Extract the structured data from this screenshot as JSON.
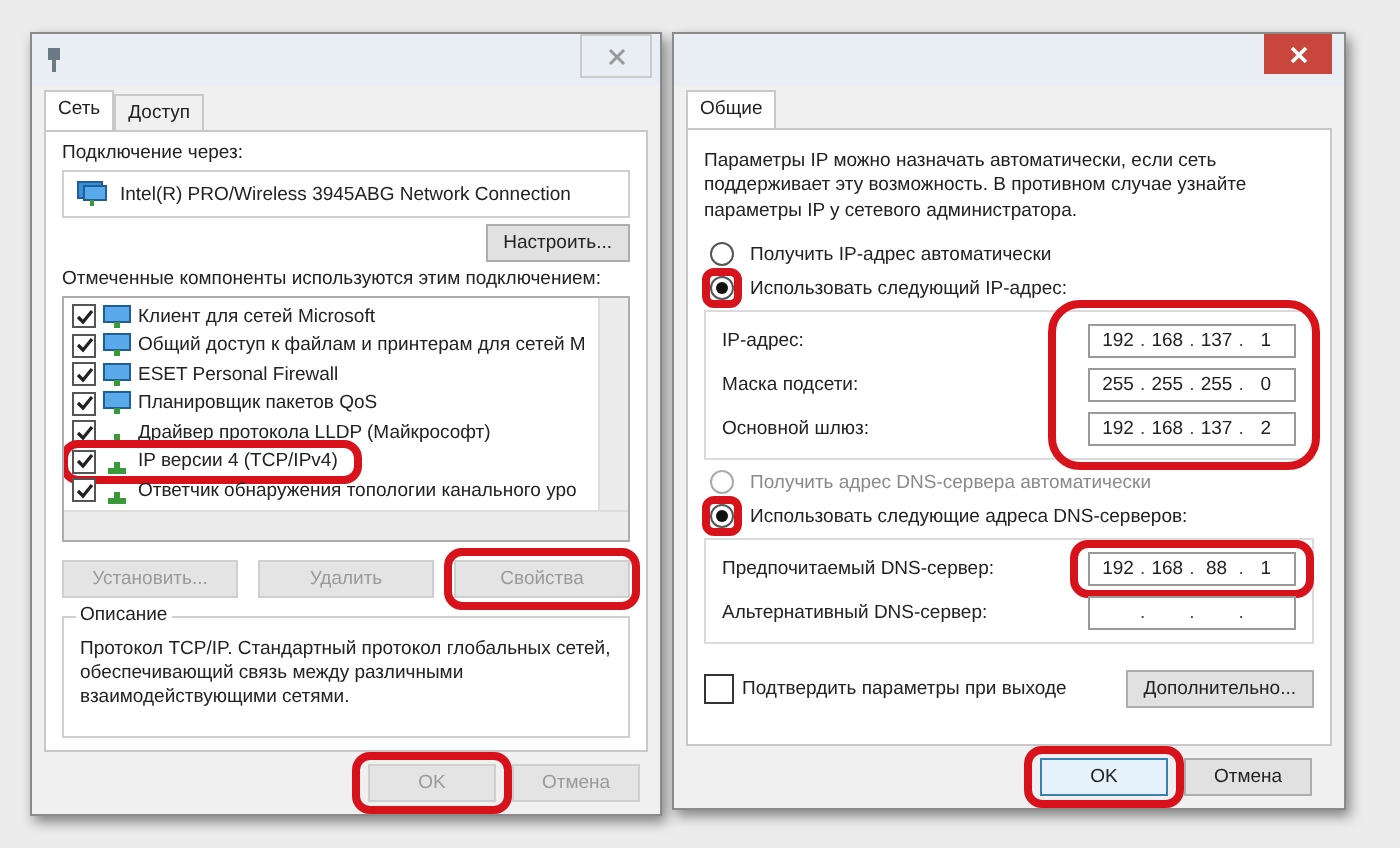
{
  "left_dialog": {
    "tabs": [
      {
        "label": "Сеть",
        "selected": true
      },
      {
        "label": "Доступ",
        "selected": false
      }
    ],
    "connect_via_label": "Подключение через:",
    "adapter": "Intel(R) PRO/Wireless 3945ABG Network Connection",
    "configure_button": "Настроить...",
    "components_label": "Отмеченные компоненты используются этим подключением:",
    "components": [
      {
        "kind": "monitor",
        "label": "Клиент для сетей Microsoft",
        "checked": true
      },
      {
        "kind": "monitor",
        "label": "Общий доступ к файлам и принтерам для сетей M",
        "checked": true
      },
      {
        "kind": "monitor",
        "label": "ESET Personal Firewall",
        "checked": true
      },
      {
        "kind": "monitor",
        "label": "Планировщик пакетов QoS",
        "checked": true
      },
      {
        "kind": "protocol",
        "label": "Драйвер протокола LLDP (Майкрософт)",
        "checked": true
      },
      {
        "kind": "protocol",
        "label": "IP версии 4 (TCP/IPv4)",
        "checked": true,
        "highlighted": true
      },
      {
        "kind": "protocol",
        "label": "Ответчик обнаружения топологии канального уро",
        "checked": true
      }
    ],
    "buttons": [
      {
        "label": "Установить...",
        "disabled": true
      },
      {
        "label": "Удалить",
        "disabled": true
      },
      {
        "label": "Свойства",
        "disabled": true,
        "highlighted": true
      }
    ],
    "description_title": "Описание",
    "description": "Протокол TCP/IP. Стандартный протокол глобальных сетей, обеспечивающий связь между различными взаимодействующими сетями.",
    "footer_buttons": [
      {
        "label": "OK",
        "disabled": true,
        "highlighted": true
      },
      {
        "label": "Отмена",
        "disabled": true
      }
    ]
  },
  "right_dialog": {
    "tabs": [
      {
        "label": "Общие",
        "selected": true
      }
    ],
    "intro": "Параметры IP можно назначать автоматически, если сеть поддерживает эту возможность. В противном случае узнайте параметры IP у сетевого администратора.",
    "octet_separator": ".",
    "ip_mode": [
      {
        "label": "Получить IP-адрес автоматически",
        "selected": false,
        "disabled": false
      },
      {
        "label": "Использовать следующий IP-адрес:",
        "selected": true,
        "disabled": false,
        "highlighted": true
      }
    ],
    "ip_fields": [
      {
        "label": "IP-адрес:",
        "octets": [
          "192",
          "168",
          "137",
          "1"
        ]
      },
      {
        "label": "Маска подсети:",
        "octets": [
          "255",
          "255",
          "255",
          "0"
        ]
      },
      {
        "label": "Основной шлюз:",
        "octets": [
          "192",
          "168",
          "137",
          "2"
        ]
      }
    ],
    "ip_fields_highlighted": true,
    "dns_mode": [
      {
        "label": "Получить адрес DNS-сервера автоматически",
        "selected": false,
        "disabled": true
      },
      {
        "label": "Использовать следующие адреса DNS-серверов:",
        "selected": true,
        "disabled": false,
        "highlighted": true
      }
    ],
    "dns_fields": [
      {
        "label": "Предпочитаемый DNS-сервер:",
        "octets": [
          "192",
          "168",
          "88",
          "1"
        ],
        "highlighted": true
      },
      {
        "label": "Альтернативный DNS-сервер:"
      }
    ],
    "confirm_on_exit": {
      "label": "Подтвердить параметры при выходе",
      "checked": false
    },
    "advanced_button": "Дополнительно...",
    "footer_buttons": [
      {
        "label": "OK",
        "default": true,
        "highlighted": true
      },
      {
        "label": "Отмена",
        "default": false
      }
    ]
  }
}
